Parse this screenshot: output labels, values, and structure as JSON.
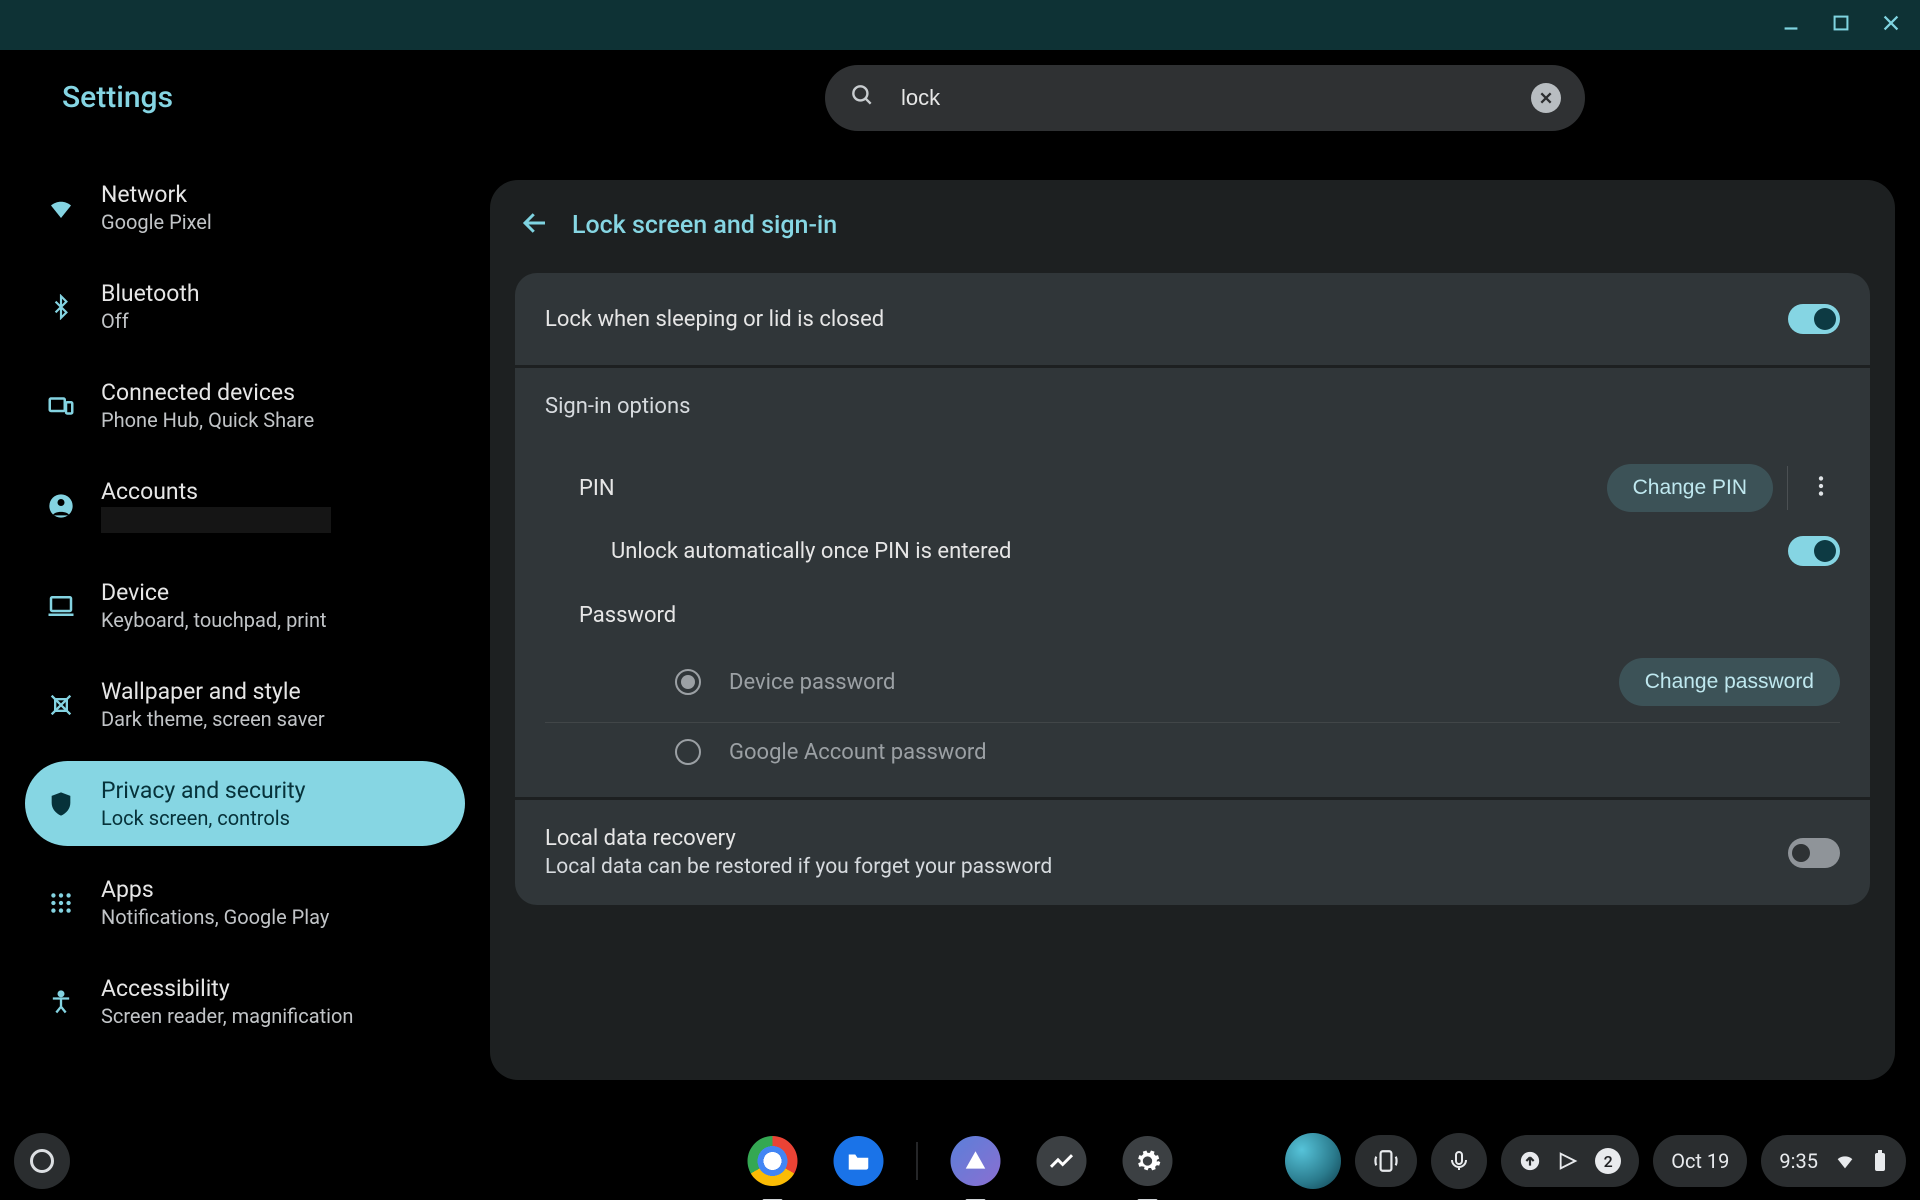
{
  "app_title": "Settings",
  "search": {
    "query": "lock"
  },
  "sidebar": {
    "items": [
      {
        "title": "Network",
        "sub": "Google Pixel"
      },
      {
        "title": "Bluetooth",
        "sub": "Off"
      },
      {
        "title": "Connected devices",
        "sub": "Phone Hub, Quick Share"
      },
      {
        "title": "Accounts",
        "sub": ""
      },
      {
        "title": "Device",
        "sub": "Keyboard, touchpad, print"
      },
      {
        "title": "Wallpaper and style",
        "sub": "Dark theme, screen saver"
      },
      {
        "title": "Privacy and security",
        "sub": "Lock screen, controls"
      },
      {
        "title": "Apps",
        "sub": "Notifications, Google Play"
      },
      {
        "title": "Accessibility",
        "sub": "Screen reader, magnification"
      }
    ]
  },
  "page": {
    "title": "Lock screen and sign-in",
    "lock_sleep": {
      "label": "Lock when sleeping or lid is closed",
      "enabled": true
    },
    "signin_heading": "Sign-in options",
    "pin": {
      "label": "PIN",
      "change_btn": "Change PIN",
      "auto_unlock": {
        "label": "Unlock automatically once PIN is entered",
        "enabled": true
      }
    },
    "password": {
      "heading": "Password",
      "options": {
        "device": {
          "label": "Device password",
          "selected": true,
          "change_btn": "Change password"
        },
        "google": {
          "label": "Google Account password",
          "selected": false
        }
      }
    },
    "recovery": {
      "title": "Local data recovery",
      "sub": "Local data can be restored if you forget your password",
      "enabled": false
    }
  },
  "shelf": {
    "notif_count": "2",
    "date": "Oct 19",
    "time": "9:35"
  }
}
